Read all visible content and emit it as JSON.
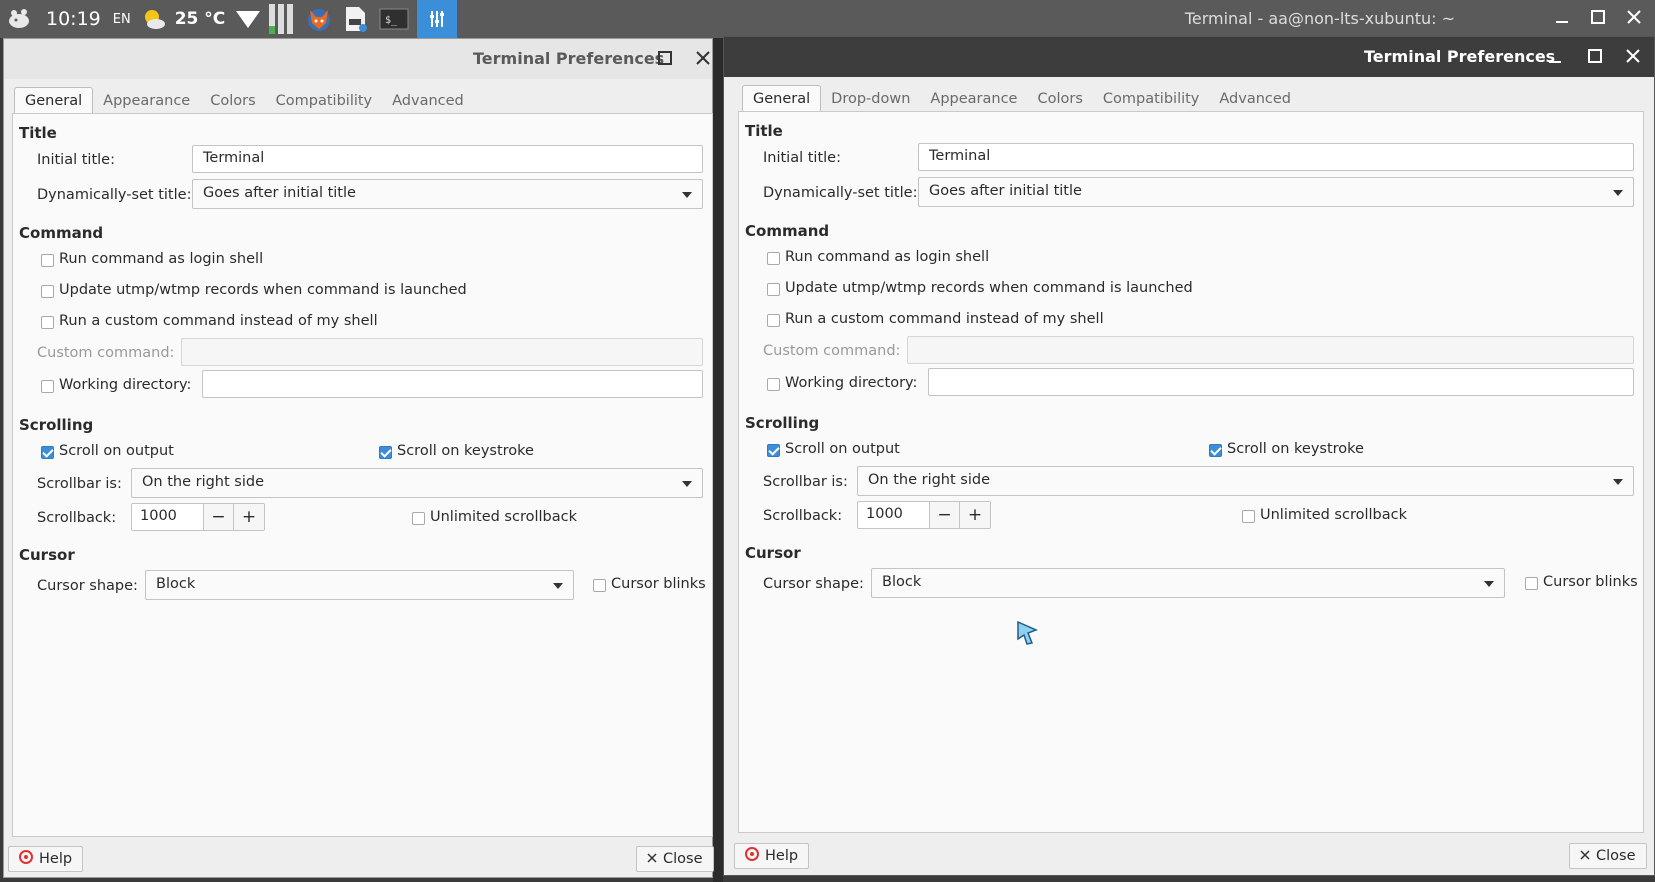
{
  "panel": {
    "time": "10:19",
    "lang": "EN",
    "temp": "25 °C",
    "active_window_title": "Terminal - aa@non-lts-xubuntu: ~"
  },
  "dialog_left": {
    "title": "Terminal Preferences",
    "tabs": [
      "General",
      "Appearance",
      "Colors",
      "Compatibility",
      "Advanced"
    ],
    "active_tab": "General"
  },
  "dialog_right": {
    "title": "Terminal Preferences",
    "tabs": [
      "General",
      "Drop-down",
      "Appearance",
      "Colors",
      "Compatibility",
      "Advanced"
    ],
    "active_tab": "General"
  },
  "general": {
    "title_section": "Title",
    "initial_title_label": "Initial title:",
    "initial_title_value": "Terminal",
    "dyn_title_label": "Dynamically-set title:",
    "dyn_title_value": "Goes after initial title",
    "command_section": "Command",
    "login_shell": "Run command as login shell",
    "utmp": "Update utmp/wtmp records when command is launched",
    "custom_cmd_check": "Run a custom command instead of my shell",
    "custom_cmd_label": "Custom command:",
    "custom_cmd_value": "",
    "workdir_label": "Working directory:",
    "workdir_value": "",
    "scrolling_section": "Scrolling",
    "scroll_output": "Scroll on output",
    "scroll_keystroke": "Scroll on keystroke",
    "scrollbar_label": "Scrollbar is:",
    "scrollbar_value": "On the right side",
    "scrollback_label": "Scrollback:",
    "scrollback_value": "1000",
    "minus": "−",
    "plus": "+",
    "unlimited": "Unlimited scrollback",
    "cursor_section": "Cursor",
    "cursor_shape_label": "Cursor shape:",
    "cursor_shape_value": "Block",
    "cursor_blinks": "Cursor blinks"
  },
  "buttons": {
    "help": "Help",
    "close": "Close"
  },
  "colors": {
    "accent": "#3c8ed6",
    "panel_bg": "#5a5a5a",
    "active_tray": "#3a8fd8"
  }
}
